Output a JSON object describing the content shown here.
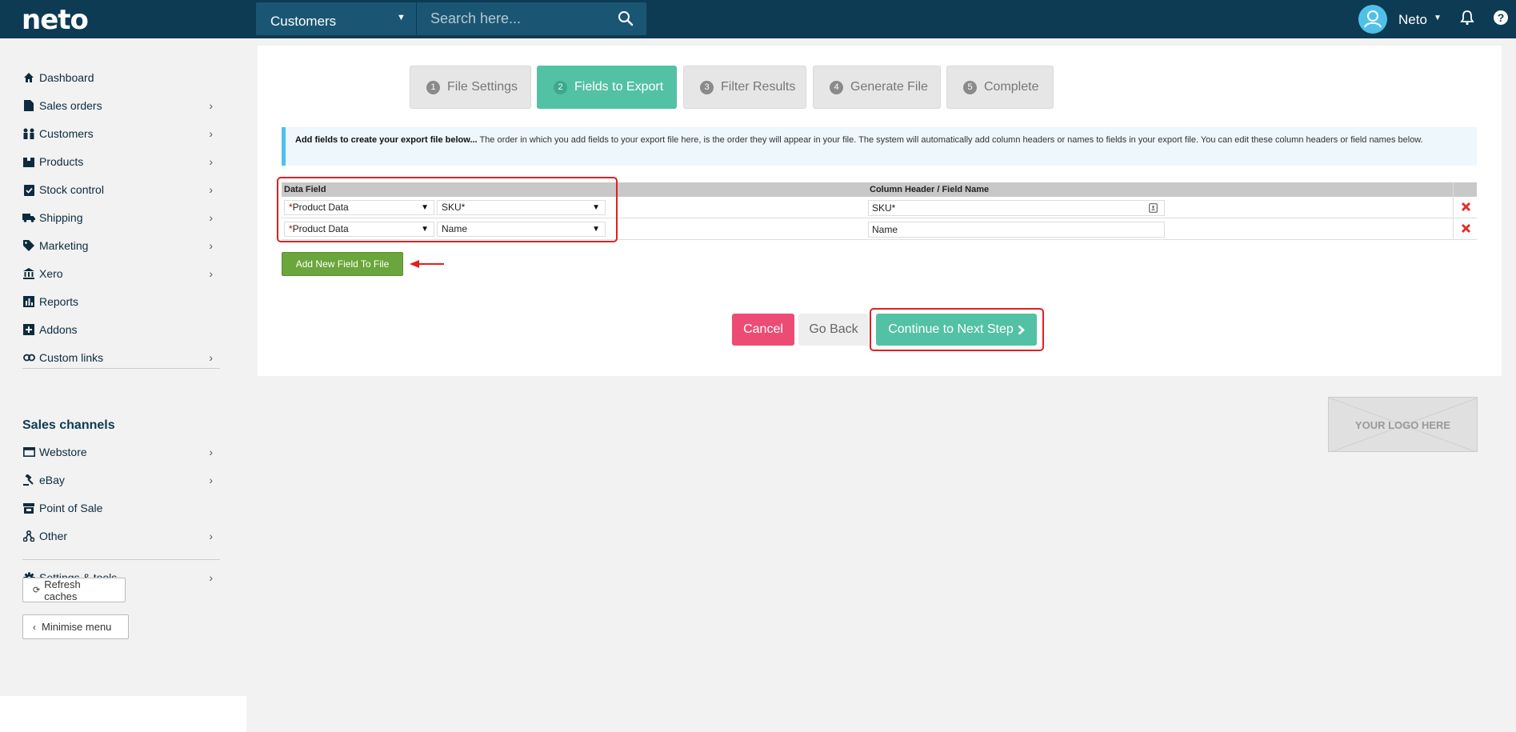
{
  "topbar": {
    "logo": "neto",
    "search_category": "Customers",
    "search_placeholder": "Search here...",
    "user_name": "Neto",
    "help_label": "?"
  },
  "sidebar": {
    "items": [
      {
        "label": "Dashboard",
        "icon": "home-icon"
      },
      {
        "label": "Sales orders",
        "icon": "document-icon"
      },
      {
        "label": "Customers",
        "icon": "people-icon"
      },
      {
        "label": "Products",
        "icon": "box-icon"
      },
      {
        "label": "Stock control",
        "icon": "clipboard-check-icon"
      },
      {
        "label": "Shipping",
        "icon": "truck-icon"
      },
      {
        "label": "Marketing",
        "icon": "tag-icon"
      },
      {
        "label": "Xero",
        "icon": "bank-icon"
      },
      {
        "label": "Reports",
        "icon": "bar-chart-icon"
      },
      {
        "label": "Addons",
        "icon": "plus-square-icon"
      },
      {
        "label": "Custom links",
        "icon": "link-icon"
      }
    ],
    "sales_channels_heading": "Sales channels",
    "channels": [
      {
        "label": "Webstore",
        "icon": "browser-icon"
      },
      {
        "label": "eBay",
        "icon": "gavel-icon"
      },
      {
        "label": "Point of Sale",
        "icon": "store-icon"
      },
      {
        "label": "Other",
        "icon": "share-icon"
      }
    ],
    "settings_label": "Settings & tools",
    "refresh_label": "Refresh caches",
    "minimise_label": "Minimise menu"
  },
  "steps": [
    {
      "num": "1",
      "label": "File Settings",
      "active": false
    },
    {
      "num": "2",
      "label": "Fields to Export",
      "active": true
    },
    {
      "num": "3",
      "label": "Filter Results",
      "active": false
    },
    {
      "num": "4",
      "label": "Generate File",
      "active": false
    },
    {
      "num": "5",
      "label": "Complete",
      "active": false
    }
  ],
  "info": {
    "bold": "Add fields to create your export file below...",
    "text": " The order in which you add fields to your export file here, is the order they will appear in your file. The system will automatically add column headers or names to fields in your export file. You can edit these column headers or field names below."
  },
  "table": {
    "col_data_field": "Data Field",
    "col_header": "Column Header / Field Name",
    "rows": [
      {
        "required_mark": "*",
        "group": "Product Data",
        "field": "SKU*",
        "header": "SKU*"
      },
      {
        "required_mark": "*",
        "group": "Product Data",
        "field": "Name",
        "header": "Name"
      }
    ]
  },
  "buttons": {
    "add_field": "Add New Field To File",
    "cancel": "Cancel",
    "go_back": "Go Back",
    "continue": "Continue to Next Step"
  },
  "logo_placeholder": "YOUR LOGO HERE",
  "colors": {
    "topbar": "#0d3b53",
    "accent_teal": "#53c1a3",
    "cancel_pink": "#ec4c74",
    "add_green": "#6aa63b",
    "highlight_red": "#e02020"
  }
}
